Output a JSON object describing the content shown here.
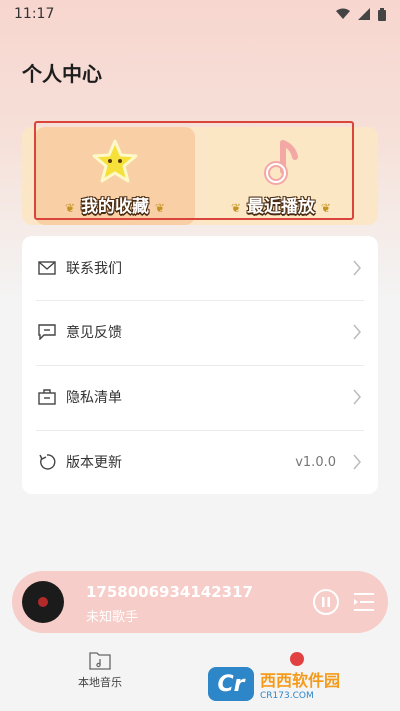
{
  "status_bar": {
    "time": "11:17"
  },
  "header": {
    "title": "个人中心"
  },
  "cards": {
    "favorites": {
      "label": "我的收藏"
    },
    "recent": {
      "label": "最近播放"
    }
  },
  "menu": {
    "items": [
      {
        "label": "联系我们",
        "icon": "mail-icon"
      },
      {
        "label": "意见反馈",
        "icon": "chat-icon"
      },
      {
        "label": "隐私清单",
        "icon": "briefcase-icon"
      },
      {
        "label": "版本更新",
        "icon": "refresh-icon",
        "value": "v1.0.0"
      }
    ]
  },
  "player": {
    "title": "1758006934142317",
    "artist": "未知歌手"
  },
  "tabbar": {
    "local_music": "本地音乐"
  },
  "watermark": {
    "brand": "西西软件园",
    "domain": "CR173.COM"
  },
  "colors": {
    "highlight": "#d9443b",
    "player_bg": "#f6cdc8",
    "fav_card": "#f9cfa6",
    "recent_card": "#fbe7c4"
  }
}
